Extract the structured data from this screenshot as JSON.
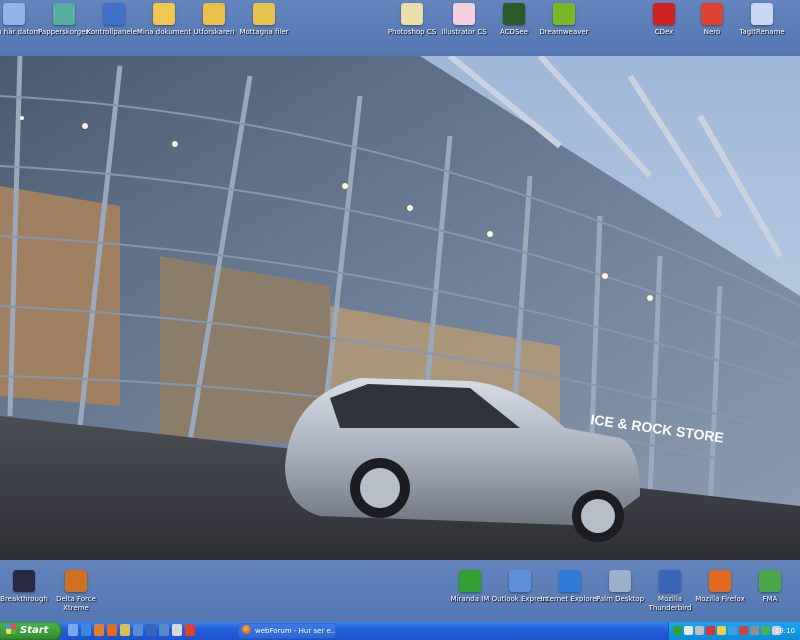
{
  "desktop_top_icons": [
    {
      "label": "Den här datorn",
      "icon": "computer-icon",
      "color": "#8fb6e8"
    },
    {
      "label": "Papperskorgen",
      "icon": "recycle-bin-icon",
      "color": "#5ab0a0"
    },
    {
      "label": "Kontrollpanelen",
      "icon": "control-panel-icon",
      "color": "#3f6fc7"
    },
    {
      "label": "Mina dokument",
      "icon": "folder-documents-icon",
      "color": "#f0c850"
    },
    {
      "label": "Utforskaren",
      "icon": "folder-explorer-icon",
      "color": "#e8c04a"
    },
    {
      "label": "Mottagna filer",
      "icon": "folder-received-icon",
      "color": "#e6c24e"
    },
    {
      "label": "Photoshop CS",
      "icon": "photoshop-icon",
      "color": "#e8e0a8"
    },
    {
      "label": "Illustrator CS",
      "icon": "illustrator-icon",
      "color": "#f4d0e0"
    },
    {
      "label": "ACDSee",
      "icon": "acdsee-icon",
      "color": "#2a5a2a"
    },
    {
      "label": "Dreamweaver",
      "icon": "dreamweaver-icon",
      "color": "#7ab828"
    },
    {
      "label": "CDex",
      "icon": "cdex-icon",
      "color": "#d02020"
    },
    {
      "label": "Nero",
      "icon": "nero-icon",
      "color": "#e04030"
    },
    {
      "label": "TagItRename",
      "icon": "tag-rename-icon",
      "color": "#c8d8f0"
    }
  ],
  "desktop_bottom_icons": [
    {
      "label": "Breakthrough",
      "icon": "breakthrough-icon",
      "color": "#2a2a40"
    },
    {
      "label": "Delta Force Xtreme",
      "icon": "delta-force-icon",
      "color": "#d07020"
    },
    {
      "label": "Miranda IM",
      "icon": "miranda-im-icon",
      "color": "#30a030"
    },
    {
      "label": "Outlook Express",
      "icon": "outlook-express-icon",
      "color": "#6090d8"
    },
    {
      "label": "Internet Explorer",
      "icon": "internet-explorer-icon",
      "color": "#2f7ad8"
    },
    {
      "label": "Palm Desktop",
      "icon": "palm-desktop-icon",
      "color": "#9ab0c8"
    },
    {
      "label": "Mozilla Thunderbird",
      "icon": "thunderbird-icon",
      "color": "#3a66b8"
    },
    {
      "label": "Mozilla Firefox",
      "icon": "firefox-icon",
      "color": "#e06a20"
    },
    {
      "label": "FMA",
      "icon": "fma-icon",
      "color": "#4aa84a"
    }
  ],
  "wallpaper": {
    "sign_text": "ICE & ROCK STORE"
  },
  "taskbar": {
    "start_label": "Start",
    "quick_launch": [
      {
        "icon": "show-desktop-icon",
        "color": "#7aa8e8"
      },
      {
        "icon": "ie-quicklaunch-icon",
        "color": "#3f86e0"
      },
      {
        "icon": "media-player-icon",
        "color": "#e08030"
      },
      {
        "icon": "firefox-quicklaunch-icon",
        "color": "#e06a20"
      },
      {
        "icon": "explorer-quicklaunch-icon",
        "color": "#d8c058"
      },
      {
        "icon": "outlook-quicklaunch-icon",
        "color": "#5a8ad8"
      },
      {
        "icon": "thunderbird-quicklaunch-icon",
        "color": "#3a66b8"
      },
      {
        "icon": "photoshop-quicklaunch-icon",
        "color": "#5a88c8"
      },
      {
        "icon": "notepad-quicklaunch-icon",
        "color": "#d8d8d8"
      },
      {
        "icon": "nero-quicklaunch-icon",
        "color": "#e04030"
      }
    ],
    "window_button": "webForum - Hur ser e...",
    "tray_icons": [
      {
        "icon": "miranda-tray-icon",
        "color": "#30a030"
      },
      {
        "icon": "network-tray-icon",
        "color": "#e8e8e8"
      },
      {
        "icon": "volume-tray-icon",
        "color": "#c0c0c0"
      },
      {
        "icon": "antivirus-tray-icon",
        "color": "#e03030"
      },
      {
        "icon": "update-tray-icon",
        "color": "#f0d040"
      },
      {
        "icon": "msn-tray-icon",
        "color": "#40a0e0"
      },
      {
        "icon": "security-tray-icon",
        "color": "#d04040"
      },
      {
        "icon": "display-tray-icon",
        "color": "#909090"
      },
      {
        "icon": "sync-tray-icon",
        "color": "#50b050"
      },
      {
        "icon": "power-tray-icon",
        "color": "#d0d0d0"
      }
    ],
    "clock": "18:10"
  }
}
